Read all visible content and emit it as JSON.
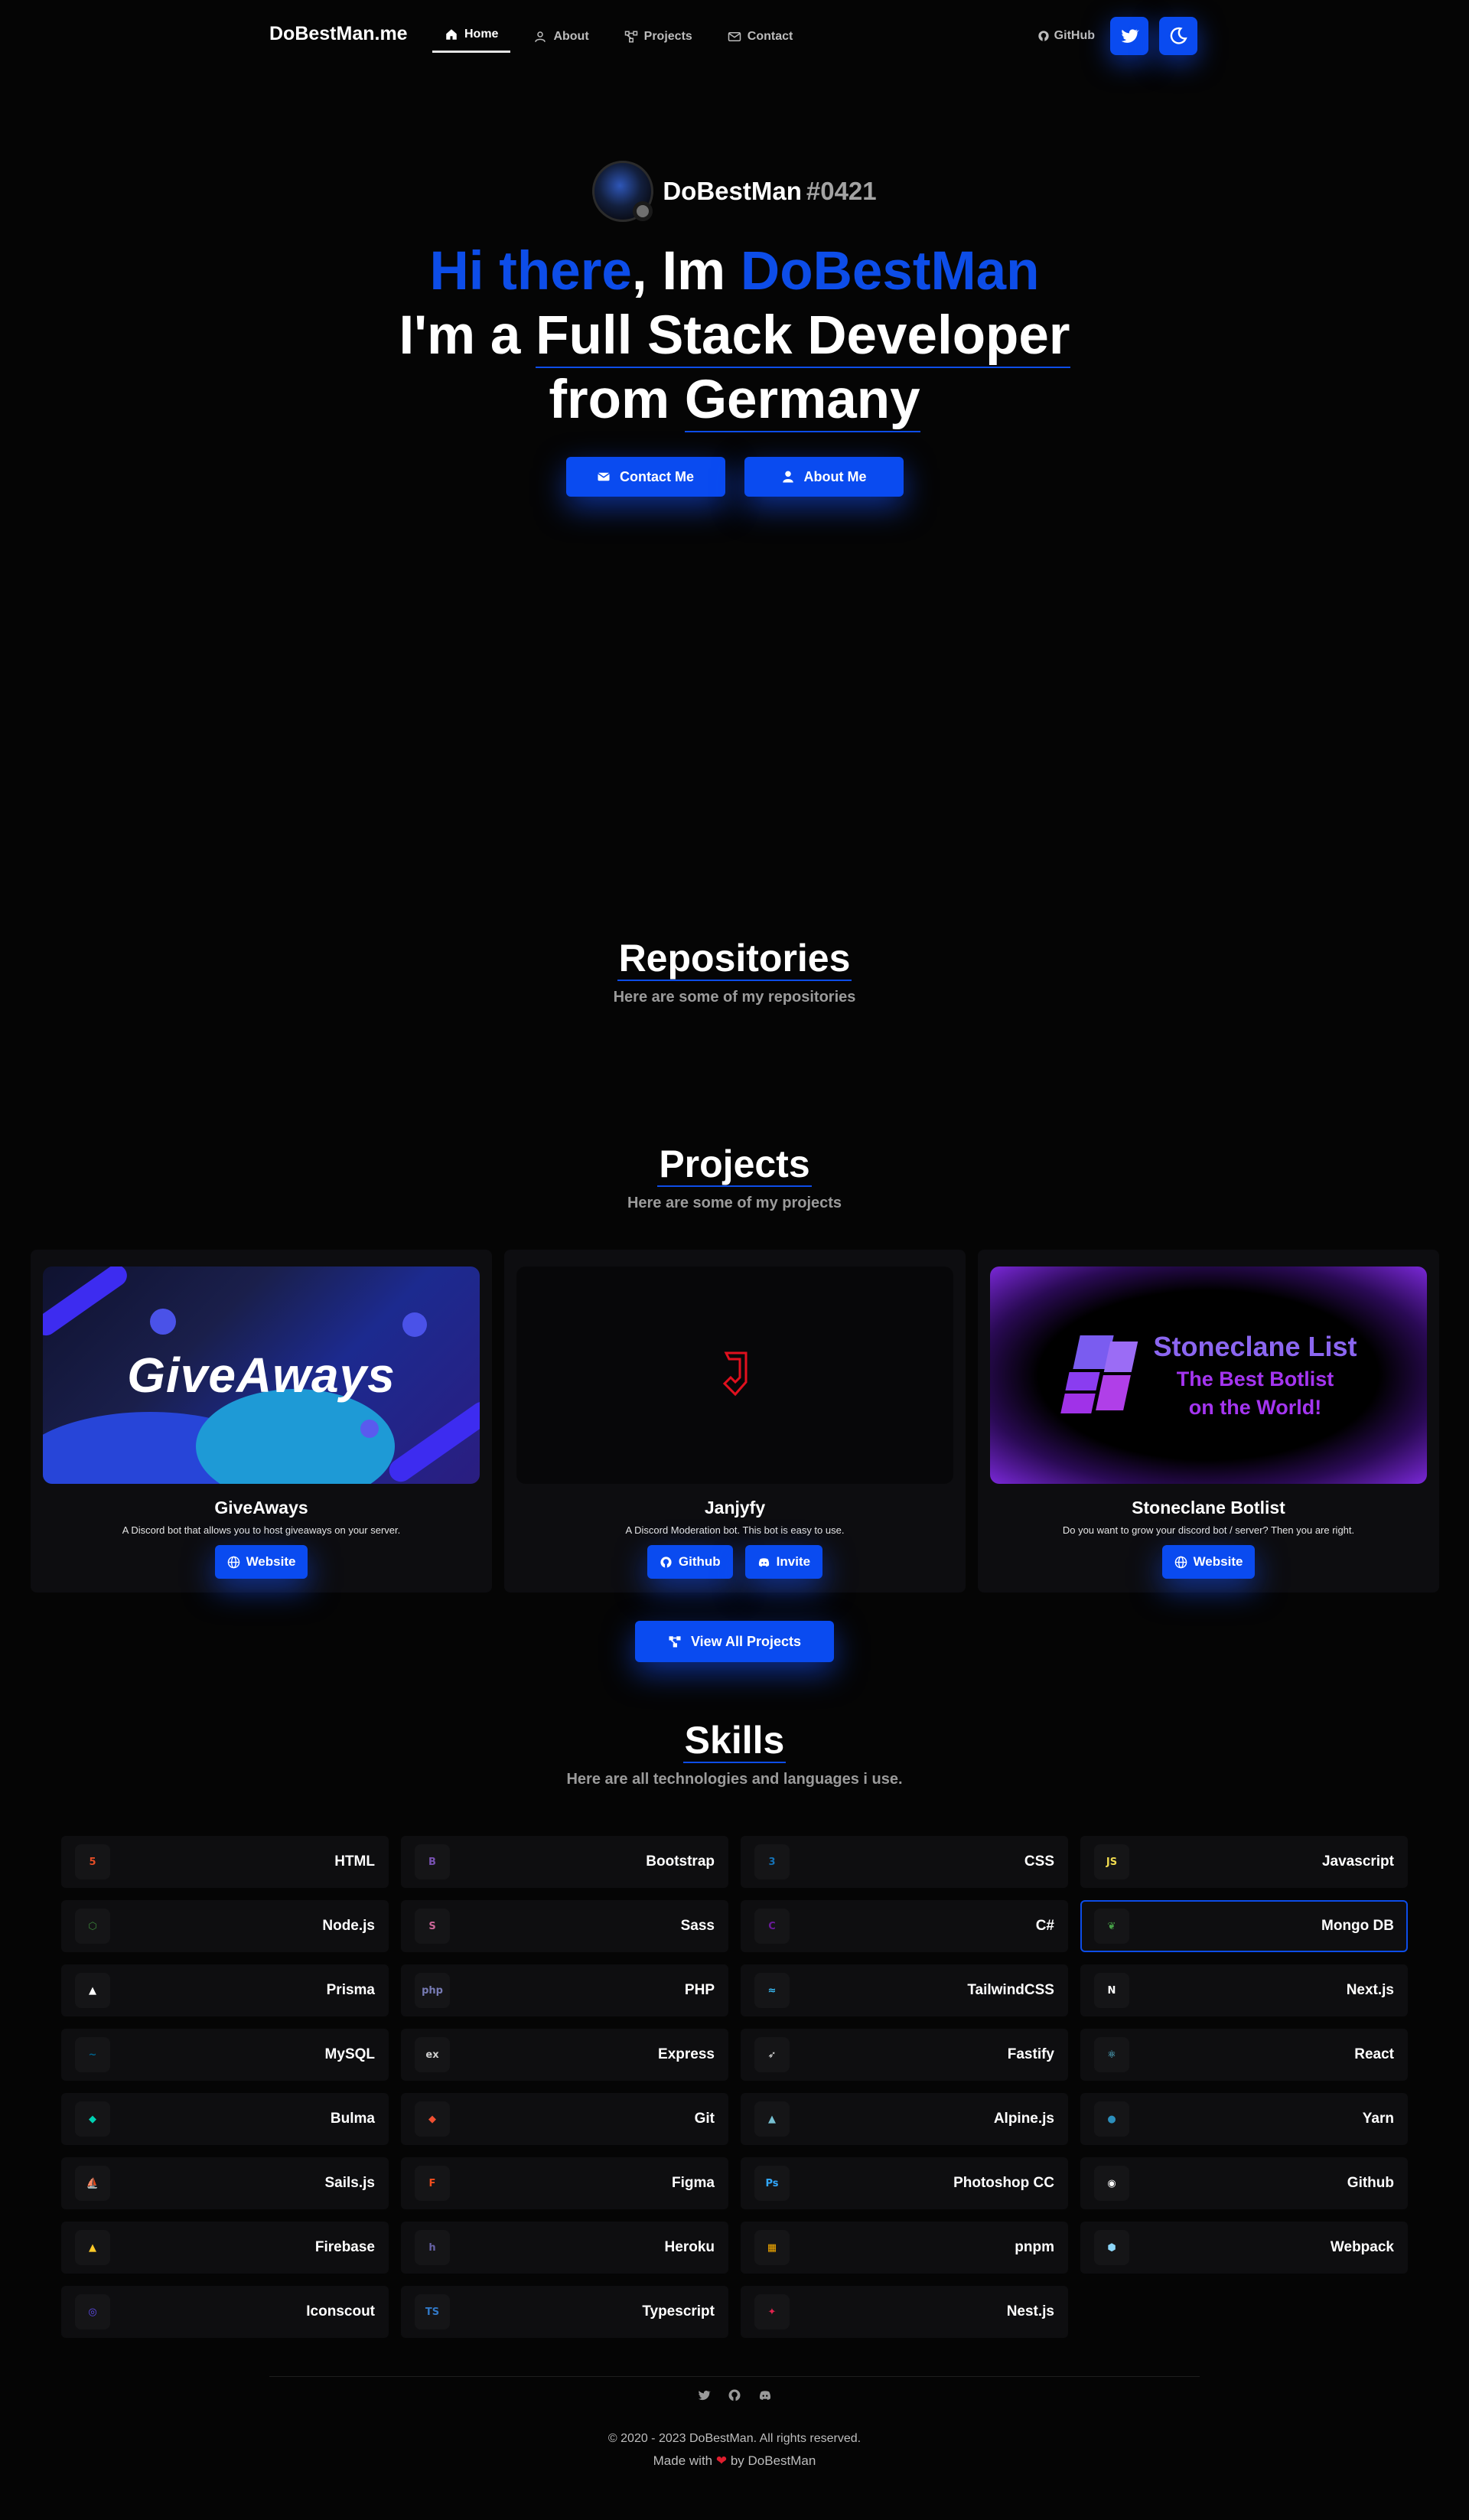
{
  "nav": {
    "brand": "DoBestMan.me",
    "links": [
      {
        "label": "Home",
        "icon": "home-icon"
      },
      {
        "label": "About",
        "icon": "user-icon"
      },
      {
        "label": "Projects",
        "icon": "projects-icon"
      },
      {
        "label": "Contact",
        "icon": "envelope-icon"
      }
    ],
    "github_label": "GitHub",
    "accent": "#0a4bf0"
  },
  "hero": {
    "username": "DoBestMan",
    "tag": "#0421",
    "greeting_blue": "Hi there",
    "greeting_mid": ", Im ",
    "greeting_name": "DoBestMan",
    "line2_prefix": "I'm a ",
    "line2_role": "Full Stack Developer",
    "line3_prefix": "from ",
    "line3_place": "Germany",
    "contact_button": "Contact Me",
    "about_button": "About Me"
  },
  "repositories": {
    "title": "Repositories",
    "subtitle": "Here are some of my repositories"
  },
  "projects": {
    "title": "Projects",
    "subtitle": "Here are some of my projects",
    "items": [
      {
        "name": "GiveAways",
        "image_text": "GiveAways",
        "description": "A Discord bot that allows you to host giveaways on your server.",
        "buttons": [
          {
            "label": "Website",
            "icon": "globe-icon"
          }
        ]
      },
      {
        "name": "Janjyfy",
        "image_text": "J",
        "description": "A Discord Moderation bot. This bot is easy to use.",
        "buttons": [
          {
            "label": "Github",
            "icon": "github-icon"
          },
          {
            "label": "Invite",
            "icon": "discord-icon"
          }
        ]
      },
      {
        "name": "Stoneclane Botlist",
        "image_text_1": "Stoneclane List",
        "image_text_2": "The Best Botlist",
        "image_text_3": "on the World!",
        "description": "Do you want to grow your discord bot / server? Then you are right.",
        "buttons": [
          {
            "label": "Website",
            "icon": "globe-icon"
          }
        ]
      }
    ],
    "view_all": "View All Projects"
  },
  "skills": {
    "title": "Skills",
    "subtitle": "Here are all technologies and languages i use.",
    "items": [
      {
        "label": "HTML",
        "icon": "html5-icon",
        "color": "#e44d26",
        "glyph": "5"
      },
      {
        "label": "Bootstrap",
        "icon": "bootstrap-icon",
        "color": "#7952b3",
        "glyph": "B"
      },
      {
        "label": "CSS",
        "icon": "css3-icon",
        "color": "#1572b6",
        "glyph": "3"
      },
      {
        "label": "Javascript",
        "icon": "javascript-icon",
        "color": "#f0db4f",
        "glyph": "JS"
      },
      {
        "label": "Node.js",
        "icon": "nodejs-icon",
        "color": "#3c873a",
        "glyph": "⬡"
      },
      {
        "label": "Sass",
        "icon": "sass-icon",
        "color": "#cc6699",
        "glyph": "S"
      },
      {
        "label": "C#",
        "icon": "csharp-icon",
        "color": "#6a1b9a",
        "glyph": "C"
      },
      {
        "label": "Mongo DB",
        "icon": "mongodb-icon",
        "color": "#47a248",
        "glyph": "❦"
      },
      {
        "label": "Prisma",
        "icon": "prisma-icon",
        "color": "#ffffff",
        "glyph": "▲"
      },
      {
        "label": "PHP",
        "icon": "php-icon",
        "color": "#777bb4",
        "glyph": "php"
      },
      {
        "label": "TailwindCSS",
        "icon": "tailwind-icon",
        "color": "#38bdf8",
        "glyph": "≈"
      },
      {
        "label": "Next.js",
        "icon": "nextjs-icon",
        "color": "#ffffff",
        "glyph": "N"
      },
      {
        "label": "MySQL",
        "icon": "mysql-icon",
        "color": "#00618a",
        "glyph": "~"
      },
      {
        "label": "Express",
        "icon": "express-icon",
        "color": "#cfcfcf",
        "glyph": "ex"
      },
      {
        "label": "Fastify",
        "icon": "fastify-icon",
        "color": "#e8e8e8",
        "glyph": "➶"
      },
      {
        "label": "React",
        "icon": "react-icon",
        "color": "#61dafb",
        "glyph": "⚛"
      },
      {
        "label": "Bulma",
        "icon": "bulma-icon",
        "color": "#00d1b2",
        "glyph": "◆"
      },
      {
        "label": "Git",
        "icon": "git-icon",
        "color": "#f05032",
        "glyph": "◆"
      },
      {
        "label": "Alpine.js",
        "icon": "alpinejs-icon",
        "color": "#77c1d2",
        "glyph": "▲"
      },
      {
        "label": "Yarn",
        "icon": "yarn-icon",
        "color": "#2c8ebb",
        "glyph": "●"
      },
      {
        "label": "Sails.js",
        "icon": "sailsjs-icon",
        "color": "#14acc2",
        "glyph": "⛵"
      },
      {
        "label": "Figma",
        "icon": "figma-icon",
        "color": "#f24e1e",
        "glyph": "F"
      },
      {
        "label": "Photoshop CC",
        "icon": "photoshop-icon",
        "color": "#31a8ff",
        "glyph": "Ps"
      },
      {
        "label": "Github",
        "icon": "github-icon",
        "color": "#ffffff",
        "glyph": "◉"
      },
      {
        "label": "Firebase",
        "icon": "firebase-icon",
        "color": "#ffca28",
        "glyph": "▲"
      },
      {
        "label": "Heroku",
        "icon": "heroku-icon",
        "color": "#6762a6",
        "glyph": "h"
      },
      {
        "label": "pnpm",
        "icon": "pnpm-icon",
        "color": "#f9ad00",
        "glyph": "▦"
      },
      {
        "label": "Webpack",
        "icon": "webpack-icon",
        "color": "#8dd6f9",
        "glyph": "⬢"
      },
      {
        "label": "Iconscout",
        "icon": "iconscout-icon",
        "color": "#5f4cf0",
        "glyph": "◎"
      },
      {
        "label": "Typescript",
        "icon": "typescript-icon",
        "color": "#3178c6",
        "glyph": "TS"
      },
      {
        "label": "Nest.js",
        "icon": "nestjs-icon",
        "color": "#e0234e",
        "glyph": "✦"
      }
    ]
  },
  "footer": {
    "icons": [
      "twitter-icon",
      "github-icon",
      "discord-icon"
    ],
    "copyright": "© 2020 - 2023 DoBestMan. All rights reserved.",
    "made_prefix": "Made with",
    "made_suffix": "by DoBestMan"
  }
}
